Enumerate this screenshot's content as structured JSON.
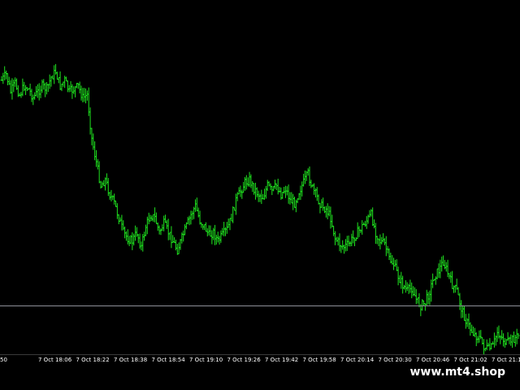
{
  "chart_data": {
    "type": "ohlc",
    "candle_color": "#1fe21f",
    "background": "#000000",
    "level_line_color": "#8d8f98",
    "x_ticks": [
      "50",
      "7 Oct 18:06",
      "7 Oct 18:22",
      "7 Oct 18:38",
      "7 Oct 18:54",
      "7 Oct 19:10",
      "7 Oct 19:26",
      "7 Oct 19:42",
      "7 Oct 19:58",
      "7 Oct 20:14",
      "7 Oct 20:30",
      "7 Oct 20:46",
      "7 Oct 21:02",
      "7 Oct 21:18",
      "7 Oc"
    ],
    "price_path": [
      0.08,
      0.06,
      0.12,
      0.09,
      0.13,
      0.1,
      0.11,
      0.14,
      0.12,
      0.1,
      0.11,
      0.07,
      0.05,
      0.1,
      0.08,
      0.12,
      0.11,
      0.1,
      0.14,
      0.13,
      0.28,
      0.36,
      0.44,
      0.42,
      0.47,
      0.5,
      0.55,
      0.6,
      0.62,
      0.63,
      0.6,
      0.65,
      0.58,
      0.54,
      0.55,
      0.6,
      0.57,
      0.6,
      0.63,
      0.66,
      0.62,
      0.58,
      0.54,
      0.51,
      0.56,
      0.58,
      0.61,
      0.6,
      0.63,
      0.61,
      0.59,
      0.55,
      0.49,
      0.46,
      0.43,
      0.42,
      0.45,
      0.47,
      0.48,
      0.44,
      0.46,
      0.44,
      0.47,
      0.45,
      0.49,
      0.5,
      0.46,
      0.43,
      0.4,
      0.45,
      0.48,
      0.51,
      0.52,
      0.55,
      0.62,
      0.64,
      0.65,
      0.64,
      0.62,
      0.6,
      0.58,
      0.56,
      0.54,
      0.6,
      0.63,
      0.64,
      0.69,
      0.71,
      0.75,
      0.78,
      0.8,
      0.79,
      0.83,
      0.85,
      0.84,
      0.8,
      0.75,
      0.73,
      0.7,
      0.74,
      0.78,
      0.8,
      0.86,
      0.9,
      0.93,
      0.95,
      0.96,
      0.99,
      1.0,
      0.99,
      0.94,
      0.96,
      0.98,
      0.97,
      0.96,
      0.95
    ]
  },
  "watermark": "www.mt4.shop"
}
